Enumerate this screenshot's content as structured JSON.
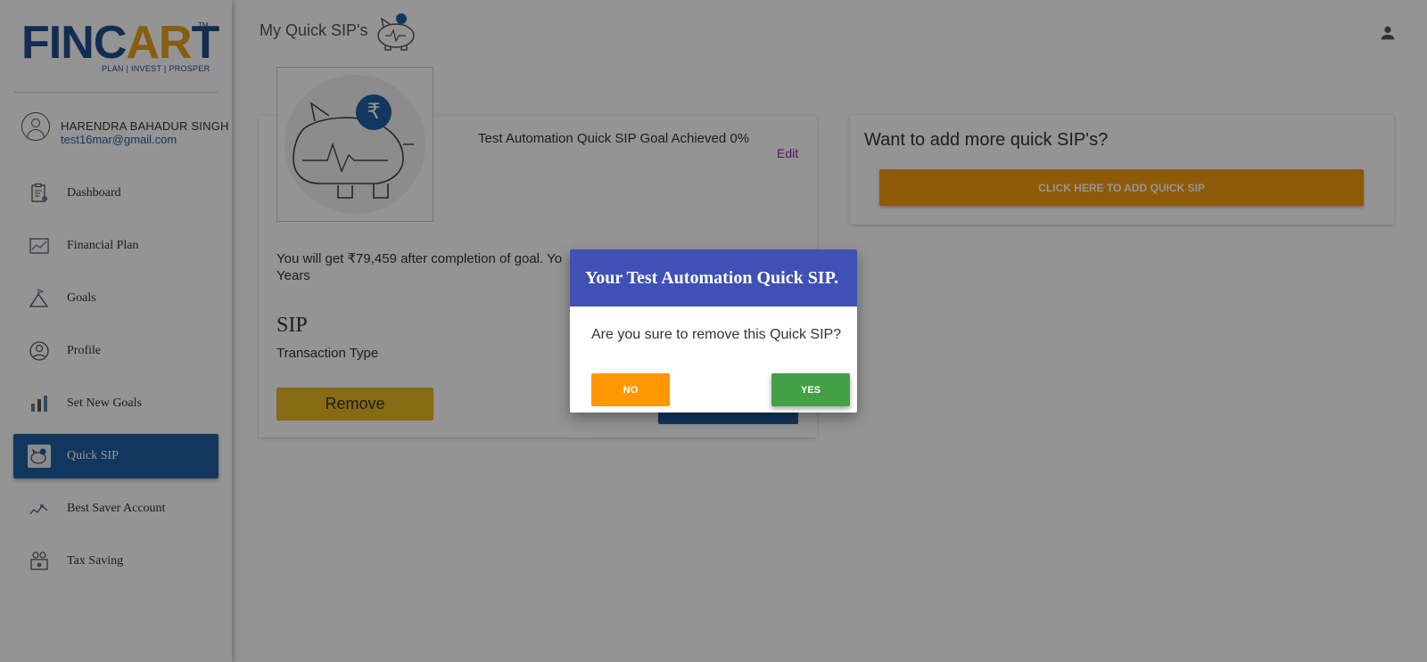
{
  "brand": {
    "logo_text_a": "FINC",
    "logo_text_b": "AR",
    "logo_text_c": "T",
    "tm": "TM",
    "tagline": "PLAN | INVEST | PROSPER",
    "primary_color": "#1f5fa3",
    "accent_color": "#e8a21d"
  },
  "user": {
    "name": "HARENDRA BAHADUR SINGH",
    "email": "test16mar@gmail.com"
  },
  "sidebar": {
    "items": [
      {
        "label": "Dashboard",
        "icon": "clipboard-icon",
        "active": false
      },
      {
        "label": "Financial Plan",
        "icon": "line-chart-icon",
        "active": false
      },
      {
        "label": "Goals",
        "icon": "mountain-flag-icon",
        "active": false
      },
      {
        "label": "Profile",
        "icon": "user-circle-icon",
        "active": false
      },
      {
        "label": "Set New Goals",
        "icon": "bar-chart-icon",
        "active": false
      },
      {
        "label": "Quick SIP",
        "icon": "piggy-bank-icon",
        "active": true
      },
      {
        "label": "Best Saver Account",
        "icon": "savings-chart-icon",
        "active": false
      },
      {
        "label": "Tax Saving",
        "icon": "tax-gift-icon",
        "active": false
      }
    ]
  },
  "header": {
    "title": "My Quick SIP's",
    "title_icon": "piggy-bank-rupee-icon",
    "user_icon": "person-icon"
  },
  "goal_card": {
    "title": "Test Automation Quick SIP Goal Achieved 0%",
    "edit_label": "Edit",
    "rupee_symbol": "₹",
    "description": "You will get ₹79,459 after completion of goal. Yo",
    "description_line2": "Years",
    "sip_heading": "SIP",
    "sip_subtitle": "Transaction Type",
    "remove_label": "Remove"
  },
  "add_card": {
    "title": "Want to add more quick SIP's?",
    "button_label": "CLICK HERE TO ADD QUICK SIP"
  },
  "dialog": {
    "title": "Your Test Automation Quick SIP.",
    "message": "Are you sure to remove this Quick SIP?",
    "no_label": "NO",
    "yes_label": "YES",
    "header_color": "#3f51b5",
    "no_color": "#ff9800",
    "yes_color": "#43a047"
  }
}
